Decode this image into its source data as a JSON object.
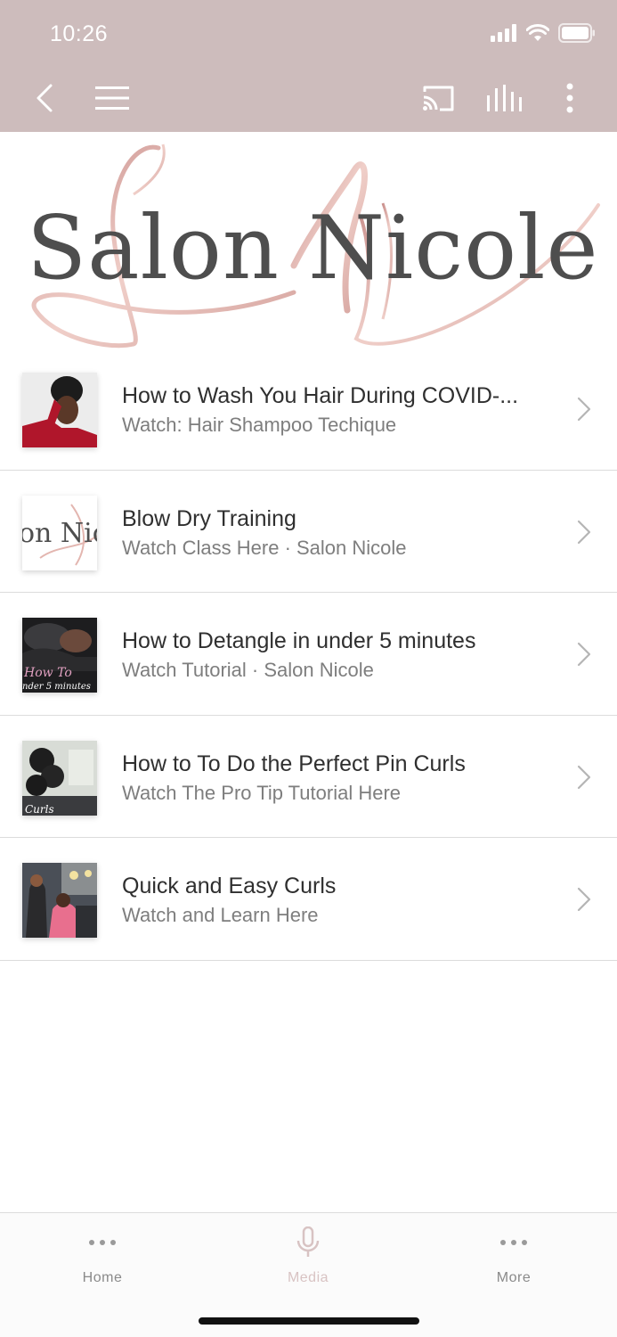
{
  "status_bar": {
    "time": "10:26"
  },
  "toolbar": {
    "icons": [
      "back-arrow-icon",
      "hamburger-menu-icon",
      "cast-icon",
      "audio-equalizer-icon",
      "more-vertical-icon"
    ]
  },
  "banner": {
    "title": "Salon Nicole",
    "flourish_color": "#d9a9a4"
  },
  "list": {
    "items": [
      {
        "title": "How to Wash You Hair During COVID-...",
        "subtitle": "Watch: Hair Shampoo Techique"
      },
      {
        "title": "Blow Dry Training",
        "subtitle": "Watch Class Here · Salon Nicole",
        "thumb_text": "on Nic"
      },
      {
        "title": "How to Detangle in under 5 minutes",
        "subtitle": "Watch Tutorial  · Salon Nicole",
        "thumb_text": "How To",
        "thumb_text2": "nder 5 minutes"
      },
      {
        "title": "How to To Do the Perfect Pin Curls",
        "subtitle": "Watch The Pro Tip Tutorial Here",
        "thumb_text": "Curls"
      },
      {
        "title": "Quick and Easy Curls",
        "subtitle": "Watch and Learn Here"
      }
    ]
  },
  "tabbar": {
    "tabs": [
      {
        "label": "Home",
        "icon": "dots-icon"
      },
      {
        "label": "Media",
        "icon": "microphone-icon",
        "active": true
      },
      {
        "label": "More",
        "icon": "dots-icon"
      }
    ]
  },
  "colors": {
    "header_bg": "#cdbcbc",
    "accent": "#d8c3c3",
    "text": "#2f2f2f"
  }
}
